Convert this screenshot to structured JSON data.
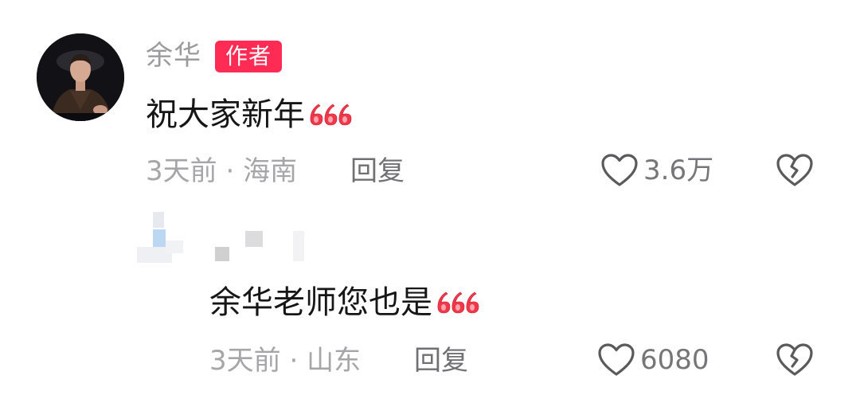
{
  "comment": {
    "author": {
      "name": "余华",
      "badge": "作者"
    },
    "text": "祝大家新年",
    "emoji": "666",
    "time": "3天前",
    "separator": "·",
    "location": "海南",
    "reply_label": "回复",
    "likes": "3.6万"
  },
  "reply": {
    "text": "余华老师您也是",
    "emoji": "666",
    "time": "3天前",
    "separator": "·",
    "location": "山东",
    "reply_label": "回复",
    "likes": "6080"
  },
  "colors": {
    "badge": "#fe2c55",
    "emoji": "#f0384a",
    "meta": "#a6a6aa"
  }
}
